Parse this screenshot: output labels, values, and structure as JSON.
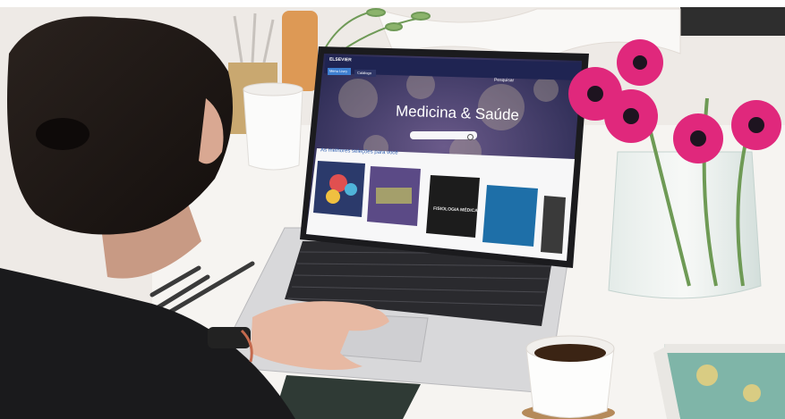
{
  "screen": {
    "brand": "ELSEVIER",
    "nav": [
      "Menu Livro",
      "Catálogo"
    ],
    "help": "Pesquisar",
    "hero_title": "Medicina & Saúde",
    "section_title": "As melhores seleções para você",
    "books": [
      {
        "title": "",
        "color": "#2b3a6b"
      },
      {
        "title": "",
        "color": "#5b4a86"
      },
      {
        "title": "FISIOLOGIA MÉDICA",
        "color": "#1c1c1c"
      },
      {
        "title": "",
        "color": "#1e6fa8"
      },
      {
        "title": "",
        "color": "#3a3a3a"
      }
    ]
  },
  "colors": {
    "background": "#f4f2ef",
    "flower": "#e0287c",
    "screen_bg": "#2b2f5a"
  }
}
